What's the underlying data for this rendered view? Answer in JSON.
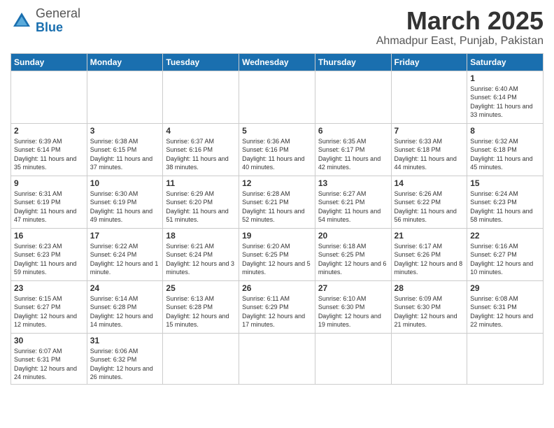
{
  "header": {
    "logo_general": "General",
    "logo_blue": "Blue",
    "title": "March 2025",
    "subtitle": "Ahmadpur East, Punjab, Pakistan"
  },
  "weekdays": [
    "Sunday",
    "Monday",
    "Tuesday",
    "Wednesday",
    "Thursday",
    "Friday",
    "Saturday"
  ],
  "days": {
    "1": {
      "sunrise": "6:40 AM",
      "sunset": "6:14 PM",
      "daylight": "11 hours and 33 minutes."
    },
    "2": {
      "sunrise": "6:39 AM",
      "sunset": "6:14 PM",
      "daylight": "11 hours and 35 minutes."
    },
    "3": {
      "sunrise": "6:38 AM",
      "sunset": "6:15 PM",
      "daylight": "11 hours and 37 minutes."
    },
    "4": {
      "sunrise": "6:37 AM",
      "sunset": "6:16 PM",
      "daylight": "11 hours and 38 minutes."
    },
    "5": {
      "sunrise": "6:36 AM",
      "sunset": "6:16 PM",
      "daylight": "11 hours and 40 minutes."
    },
    "6": {
      "sunrise": "6:35 AM",
      "sunset": "6:17 PM",
      "daylight": "11 hours and 42 minutes."
    },
    "7": {
      "sunrise": "6:33 AM",
      "sunset": "6:18 PM",
      "daylight": "11 hours and 44 minutes."
    },
    "8": {
      "sunrise": "6:32 AM",
      "sunset": "6:18 PM",
      "daylight": "11 hours and 45 minutes."
    },
    "9": {
      "sunrise": "6:31 AM",
      "sunset": "6:19 PM",
      "daylight": "11 hours and 47 minutes."
    },
    "10": {
      "sunrise": "6:30 AM",
      "sunset": "6:19 PM",
      "daylight": "11 hours and 49 minutes."
    },
    "11": {
      "sunrise": "6:29 AM",
      "sunset": "6:20 PM",
      "daylight": "11 hours and 51 minutes."
    },
    "12": {
      "sunrise": "6:28 AM",
      "sunset": "6:21 PM",
      "daylight": "11 hours and 52 minutes."
    },
    "13": {
      "sunrise": "6:27 AM",
      "sunset": "6:21 PM",
      "daylight": "11 hours and 54 minutes."
    },
    "14": {
      "sunrise": "6:26 AM",
      "sunset": "6:22 PM",
      "daylight": "11 hours and 56 minutes."
    },
    "15": {
      "sunrise": "6:24 AM",
      "sunset": "6:23 PM",
      "daylight": "11 hours and 58 minutes."
    },
    "16": {
      "sunrise": "6:23 AM",
      "sunset": "6:23 PM",
      "daylight": "11 hours and 59 minutes."
    },
    "17": {
      "sunrise": "6:22 AM",
      "sunset": "6:24 PM",
      "daylight": "12 hours and 1 minute."
    },
    "18": {
      "sunrise": "6:21 AM",
      "sunset": "6:24 PM",
      "daylight": "12 hours and 3 minutes."
    },
    "19": {
      "sunrise": "6:20 AM",
      "sunset": "6:25 PM",
      "daylight": "12 hours and 5 minutes."
    },
    "20": {
      "sunrise": "6:18 AM",
      "sunset": "6:25 PM",
      "daylight": "12 hours and 6 minutes."
    },
    "21": {
      "sunrise": "6:17 AM",
      "sunset": "6:26 PM",
      "daylight": "12 hours and 8 minutes."
    },
    "22": {
      "sunrise": "6:16 AM",
      "sunset": "6:27 PM",
      "daylight": "12 hours and 10 minutes."
    },
    "23": {
      "sunrise": "6:15 AM",
      "sunset": "6:27 PM",
      "daylight": "12 hours and 12 minutes."
    },
    "24": {
      "sunrise": "6:14 AM",
      "sunset": "6:28 PM",
      "daylight": "12 hours and 14 minutes."
    },
    "25": {
      "sunrise": "6:13 AM",
      "sunset": "6:28 PM",
      "daylight": "12 hours and 15 minutes."
    },
    "26": {
      "sunrise": "6:11 AM",
      "sunset": "6:29 PM",
      "daylight": "12 hours and 17 minutes."
    },
    "27": {
      "sunrise": "6:10 AM",
      "sunset": "6:30 PM",
      "daylight": "12 hours and 19 minutes."
    },
    "28": {
      "sunrise": "6:09 AM",
      "sunset": "6:30 PM",
      "daylight": "12 hours and 21 minutes."
    },
    "29": {
      "sunrise": "6:08 AM",
      "sunset": "6:31 PM",
      "daylight": "12 hours and 22 minutes."
    },
    "30": {
      "sunrise": "6:07 AM",
      "sunset": "6:31 PM",
      "daylight": "12 hours and 24 minutes."
    },
    "31": {
      "sunrise": "6:06 AM",
      "sunset": "6:32 PM",
      "daylight": "12 hours and 26 minutes."
    }
  }
}
